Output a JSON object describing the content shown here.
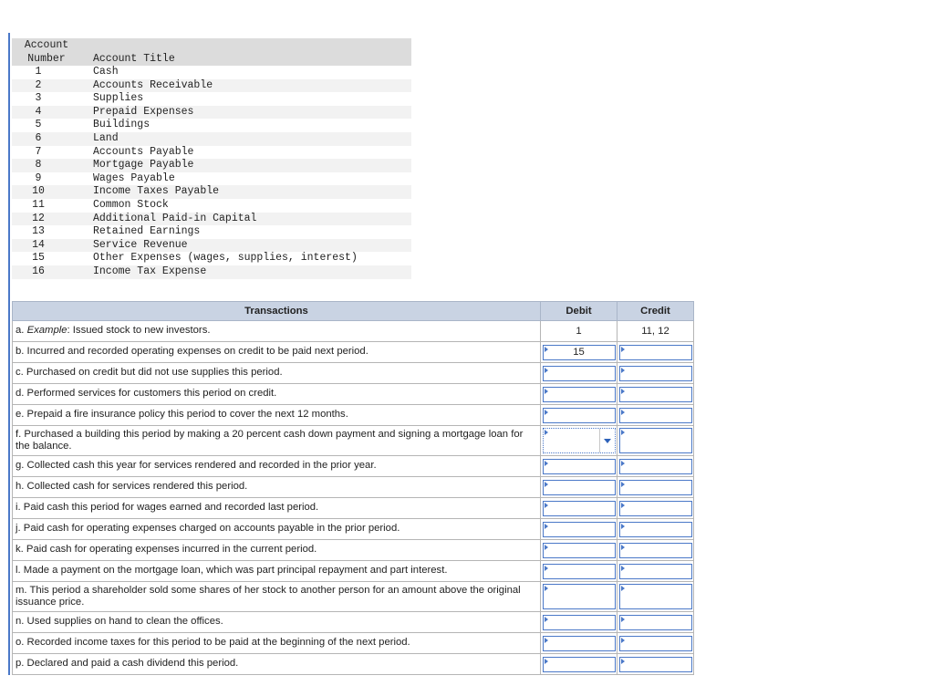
{
  "accounts": {
    "header_number_line1": "Account",
    "header_number_line2": "Number",
    "header_title": "Account Title",
    "rows": [
      {
        "number": "1",
        "title": "Cash"
      },
      {
        "number": "2",
        "title": "Accounts Receivable"
      },
      {
        "number": "3",
        "title": "Supplies"
      },
      {
        "number": "4",
        "title": "Prepaid Expenses"
      },
      {
        "number": "5",
        "title": "Buildings"
      },
      {
        "number": "6",
        "title": "Land"
      },
      {
        "number": "7",
        "title": "Accounts Payable"
      },
      {
        "number": "8",
        "title": "Mortgage Payable"
      },
      {
        "number": "9",
        "title": "Wages Payable"
      },
      {
        "number": "10",
        "title": "Income Taxes Payable"
      },
      {
        "number": "11",
        "title": "Common Stock"
      },
      {
        "number": "12",
        "title": "Additional Paid-in Capital"
      },
      {
        "number": "13",
        "title": "Retained Earnings"
      },
      {
        "number": "14",
        "title": "Service Revenue"
      },
      {
        "number": "15",
        "title": "Other Expenses (wages, supplies, interest)"
      },
      {
        "number": "16",
        "title": "Income Tax Expense"
      }
    ]
  },
  "transactions": {
    "header_transactions": "Transactions",
    "header_debit": "Debit",
    "header_credit": "Credit",
    "example": {
      "letter": "a.",
      "italic": "Example",
      "text": ": Issued stock to new investors.",
      "debit": "1",
      "credit": "11, 12"
    },
    "rows": [
      {
        "text": "b. Incurred and recorded operating expenses on credit to be paid next period.",
        "debit": "15",
        "credit": ""
      },
      {
        "text": "c. Purchased on credit but did not use supplies this period.",
        "debit": "",
        "credit": ""
      },
      {
        "text": "d. Performed services for customers this period on credit.",
        "debit": "",
        "credit": ""
      },
      {
        "text": "e. Prepaid a fire insurance policy this period to cover the next 12 months.",
        "debit": "",
        "credit": ""
      },
      {
        "text": "f. Purchased a building this period by making a 20 percent cash down payment and signing a mortgage loan for the balance.",
        "debit": "",
        "credit": ""
      },
      {
        "text": "g. Collected cash this year for services rendered and recorded in the prior year.",
        "debit": "",
        "credit": ""
      },
      {
        "text": "h. Collected cash for services rendered this period.",
        "debit": "",
        "credit": ""
      },
      {
        "text": "i. Paid cash this period for wages earned and recorded last period.",
        "debit": "",
        "credit": ""
      },
      {
        "text": "j. Paid cash for operating expenses charged on accounts payable in the prior period.",
        "debit": "",
        "credit": ""
      },
      {
        "text": "k. Paid cash for operating expenses incurred in the current period.",
        "debit": "",
        "credit": ""
      },
      {
        "text": "l. Made a payment on the mortgage loan, which was part principal repayment and part interest.",
        "debit": "",
        "credit": ""
      },
      {
        "text": "m. This period a shareholder sold some shares of her stock to another person for an amount above the original issuance price.",
        "debit": "",
        "credit": ""
      },
      {
        "text": "n. Used supplies on hand to clean the offices.",
        "debit": "",
        "credit": ""
      },
      {
        "text": "o. Recorded income taxes for this period to be paid at the beginning of the next period.",
        "debit": "",
        "credit": ""
      },
      {
        "text": "p. Declared and paid a cash dividend this period.",
        "debit": "",
        "credit": ""
      }
    ],
    "dropdown_icon": "chevron-down-icon",
    "accent_color": "#4a78c8",
    "header_color": "#c9d3e3"
  }
}
